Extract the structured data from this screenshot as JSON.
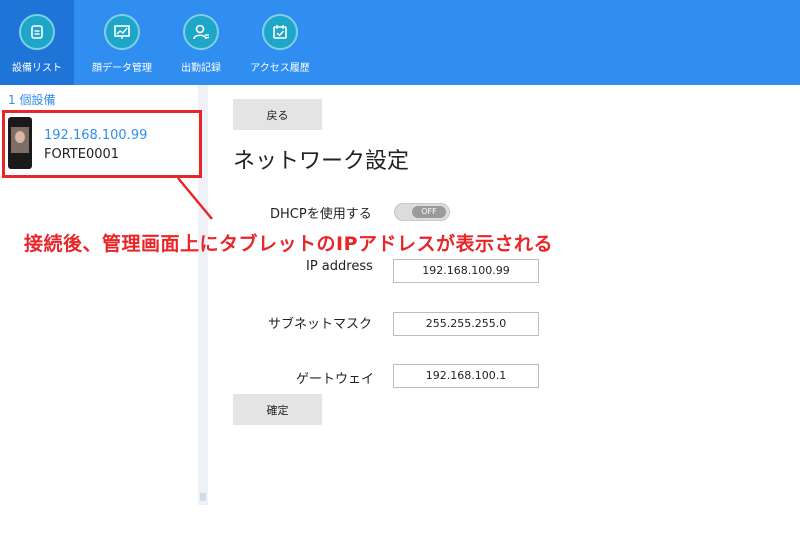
{
  "toolbar": {
    "items": [
      {
        "label": "設備リスト",
        "icon": "device-list-icon",
        "active": true
      },
      {
        "label": "顔データ管理",
        "icon": "face-data-icon",
        "active": false
      },
      {
        "label": "出勤記録",
        "icon": "attendance-icon",
        "active": false
      },
      {
        "label": "アクセス履歴",
        "icon": "access-history-icon",
        "active": false
      }
    ]
  },
  "sidebar": {
    "count_label": "1 個設備",
    "device": {
      "ip": "192.168.100.99",
      "name": "FORTE0001"
    }
  },
  "main": {
    "back_label": "戻る",
    "title": "ネットワーク設定",
    "dhcp_label": "DHCPを使用する",
    "dhcp_toggle": "OFF",
    "ip_label": "IP address",
    "ip_value": "192.168.100.99",
    "mask_label": "サブネットマスク",
    "mask_value": "255.255.255.0",
    "gateway_label": "ゲートウェイ",
    "gateway_value": "192.168.100.1",
    "confirm_label": "確定"
  },
  "annotation": {
    "text": "接続後、管理画面上にタブレットのIPアドレスが表示される",
    "color": "#e8262a"
  },
  "colors": {
    "toolbar_bg": "#2f8ef0",
    "toolbar_active": "#1f74d8",
    "icon_circle": "#1ea6c9",
    "link_blue": "#2f8ef0"
  }
}
